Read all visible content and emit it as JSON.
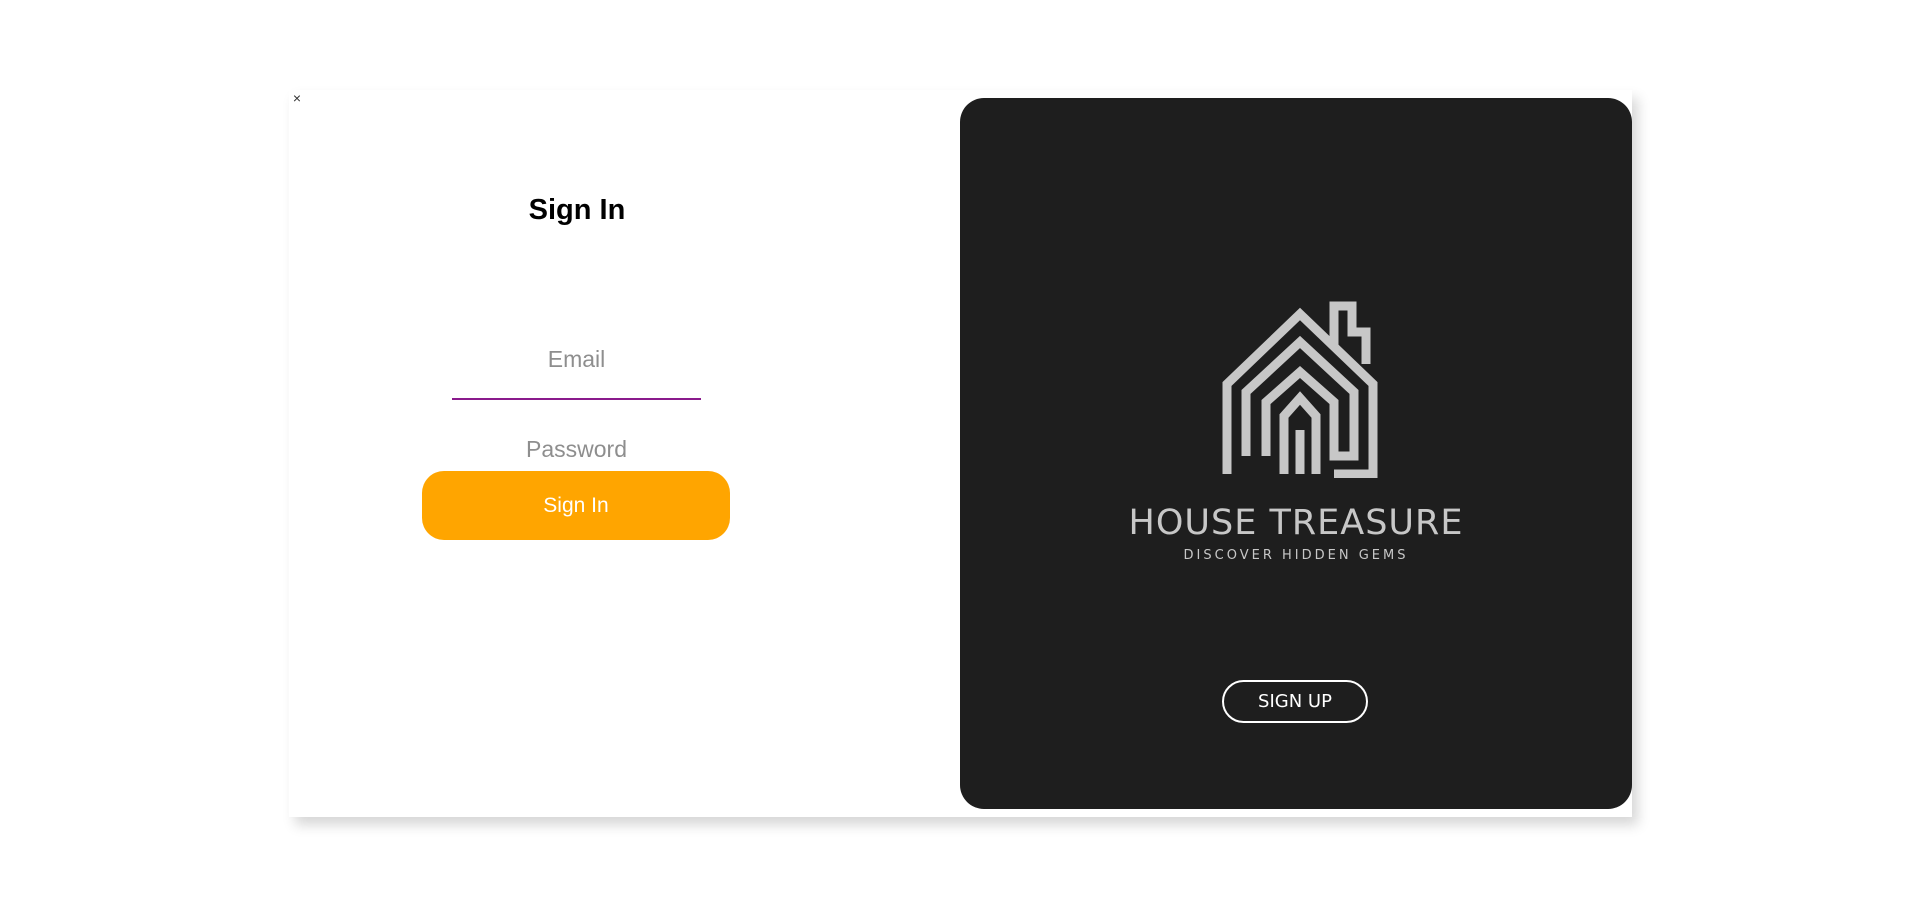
{
  "close": {
    "label": "×"
  },
  "signin": {
    "title": "Sign In",
    "email_placeholder": "Email",
    "password_placeholder": "Password",
    "button_label": "Sign In",
    "field_underline_color": "#8a1a8c",
    "button_color": "#ffa500"
  },
  "brand": {
    "name": "HOUSE TREASURE",
    "tagline": "DISCOVER HIDDEN GEMS",
    "logo_icon": "house-maze-icon",
    "panel_color": "#1e1e1e",
    "signup_label": "SIGN UP"
  }
}
